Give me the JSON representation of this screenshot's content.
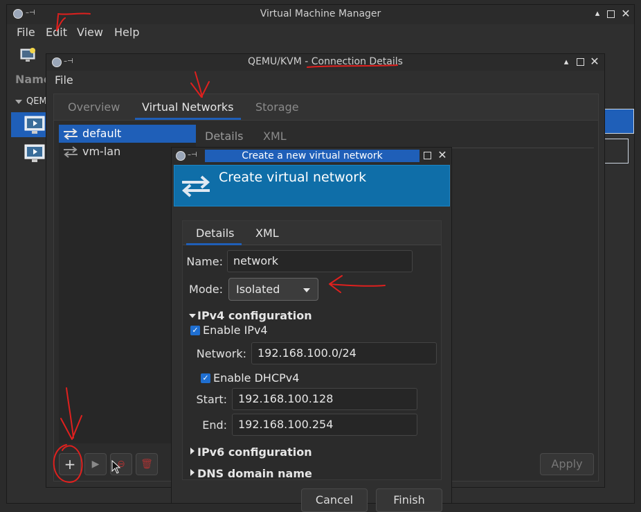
{
  "main_window": {
    "title": "Virtual Machine Manager",
    "menu": [
      "File",
      "Edit",
      "View",
      "Help"
    ],
    "list_header": "Name",
    "group": "QEMU"
  },
  "details_window": {
    "title_prefix": "QEMU/KVM - ",
    "title_suffix": "Connection Details",
    "menu_file": "File",
    "tabs": [
      "Overview",
      "Virtual Networks",
      "Storage"
    ],
    "networks": [
      "default",
      "vm-lan"
    ],
    "subtabs": [
      "Details",
      "XML"
    ],
    "apply_label": "Apply"
  },
  "dialog": {
    "title": "Create a new virtual network",
    "banner": "Create virtual network",
    "tabs": [
      "Details",
      "XML"
    ],
    "name_label": "Name:",
    "name_value": "network",
    "mode_label": "Mode:",
    "mode_value": "Isolated",
    "ipv4_section": "IPv4 configuration",
    "enable_ipv4": "Enable IPv4",
    "network_label": "Network:",
    "network_value": "192.168.100.0/24",
    "enable_dhcp": "Enable DHCPv4",
    "start_label": "Start:",
    "start_value": "192.168.100.128",
    "end_label": "End:",
    "end_value": "192.168.100.254",
    "ipv6_section": "IPv6 configuration",
    "dns_section": "DNS domain name",
    "cancel_label": "Cancel",
    "finish_label": "Finish"
  },
  "colors": {
    "accent": "#1f5fb8",
    "banner": "#0f6ea8",
    "annotation": "#e0201e"
  }
}
